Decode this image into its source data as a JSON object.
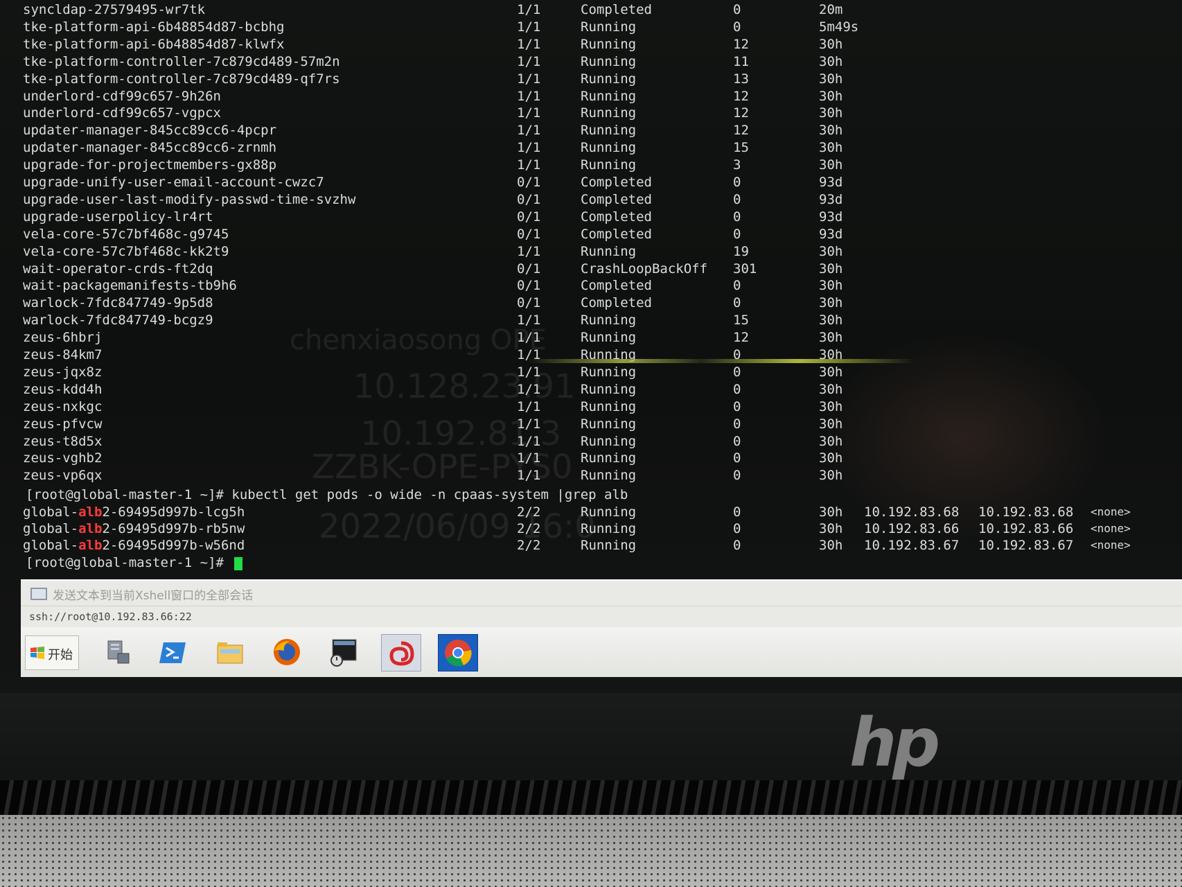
{
  "terminal": {
    "rows": [
      {
        "name": "syncldap-27579495-wr7tk",
        "ready": "1/1",
        "status": "Completed",
        "restarts": "0",
        "age": "20m"
      },
      {
        "name": "tke-platform-api-6b48854d87-bcbhg",
        "ready": "1/1",
        "status": "Running",
        "restarts": "0",
        "age": "5m49s"
      },
      {
        "name": "tke-platform-api-6b48854d87-klwfx",
        "ready": "1/1",
        "status": "Running",
        "restarts": "12",
        "age": "30h"
      },
      {
        "name": "tke-platform-controller-7c879cd489-57m2n",
        "ready": "1/1",
        "status": "Running",
        "restarts": "11",
        "age": "30h"
      },
      {
        "name": "tke-platform-controller-7c879cd489-qf7rs",
        "ready": "1/1",
        "status": "Running",
        "restarts": "13",
        "age": "30h"
      },
      {
        "name": "underlord-cdf99c657-9h26n",
        "ready": "1/1",
        "status": "Running",
        "restarts": "12",
        "age": "30h"
      },
      {
        "name": "underlord-cdf99c657-vgpcx",
        "ready": "1/1",
        "status": "Running",
        "restarts": "12",
        "age": "30h"
      },
      {
        "name": "updater-manager-845cc89cc6-4pcpr",
        "ready": "1/1",
        "status": "Running",
        "restarts": "12",
        "age": "30h"
      },
      {
        "name": "updater-manager-845cc89cc6-zrnmh",
        "ready": "1/1",
        "status": "Running",
        "restarts": "15",
        "age": "30h"
      },
      {
        "name": "upgrade-for-projectmembers-gx88p",
        "ready": "1/1",
        "status": "Running",
        "restarts": "3",
        "age": "30h"
      },
      {
        "name": "upgrade-unify-user-email-account-cwzc7",
        "ready": "0/1",
        "status": "Completed",
        "restarts": "0",
        "age": "93d"
      },
      {
        "name": "upgrade-user-last-modify-passwd-time-svzhw",
        "ready": "0/1",
        "status": "Completed",
        "restarts": "0",
        "age": "93d"
      },
      {
        "name": "upgrade-userpolicy-lr4rt",
        "ready": "0/1",
        "status": "Completed",
        "restarts": "0",
        "age": "93d"
      },
      {
        "name": "vela-core-57c7bf468c-g9745",
        "ready": "0/1",
        "status": "Completed",
        "restarts": "0",
        "age": "93d"
      },
      {
        "name": "vela-core-57c7bf468c-kk2t9",
        "ready": "1/1",
        "status": "Running",
        "restarts": "19",
        "age": "30h"
      },
      {
        "name": "wait-operator-crds-ft2dq",
        "ready": "0/1",
        "status": "CrashLoopBackOff",
        "restarts": "301",
        "age": "30h"
      },
      {
        "name": "wait-packagemanifests-tb9h6",
        "ready": "0/1",
        "status": "Completed",
        "restarts": "0",
        "age": "30h"
      },
      {
        "name": "warlock-7fdc847749-9p5d8",
        "ready": "0/1",
        "status": "Completed",
        "restarts": "0",
        "age": "30h"
      },
      {
        "name": "warlock-7fdc847749-bcgz9",
        "ready": "1/1",
        "status": "Running",
        "restarts": "15",
        "age": "30h"
      },
      {
        "name": "zeus-6hbrj",
        "ready": "1/1",
        "status": "Running",
        "restarts": "12",
        "age": "30h"
      },
      {
        "name": "zeus-84km7",
        "ready": "1/1",
        "status": "Running",
        "restarts": "0",
        "age": "30h"
      },
      {
        "name": "zeus-jqx8z",
        "ready": "1/1",
        "status": "Running",
        "restarts": "0",
        "age": "30h"
      },
      {
        "name": "zeus-kdd4h",
        "ready": "1/1",
        "status": "Running",
        "restarts": "0",
        "age": "30h"
      },
      {
        "name": "zeus-nxkgc",
        "ready": "1/1",
        "status": "Running",
        "restarts": "0",
        "age": "30h"
      },
      {
        "name": "zeus-pfvcw",
        "ready": "1/1",
        "status": "Running",
        "restarts": "0",
        "age": "30h"
      },
      {
        "name": "zeus-t8d5x",
        "ready": "1/1",
        "status": "Running",
        "restarts": "0",
        "age": "30h"
      },
      {
        "name": "zeus-vghb2",
        "ready": "1/1",
        "status": "Running",
        "restarts": "0",
        "age": "30h"
      },
      {
        "name": "zeus-vp6qx",
        "ready": "1/1",
        "status": "Running",
        "restarts": "0",
        "age": "30h"
      }
    ],
    "command_line": "[root@global-master-1 ~]# kubectl get pods -o wide -n cpaas-system |grep alb",
    "alb_rows": [
      {
        "prefix": "global-",
        "match": "alb",
        "suffix": "2-69495d997b-lcg5h",
        "ready": "2/2",
        "status": "Running",
        "restarts": "0",
        "age": "30h",
        "ip": "10.192.83.68",
        "node": "10.192.83.68",
        "nominated": "<none>"
      },
      {
        "prefix": "global-",
        "match": "alb",
        "suffix": "2-69495d997b-rb5nw",
        "ready": "2/2",
        "status": "Running",
        "restarts": "0",
        "age": "30h",
        "ip": "10.192.83.66",
        "node": "10.192.83.66",
        "nominated": "<none>"
      },
      {
        "prefix": "global-",
        "match": "alb",
        "suffix": "2-69495d997b-w56nd",
        "ready": "2/2",
        "status": "Running",
        "restarts": "0",
        "age": "30h",
        "ip": "10.192.83.67",
        "node": "10.192.83.67",
        "nominated": "<none>"
      }
    ],
    "final_prompt": "[root@global-master-1 ~]#",
    "watermark": [
      "chenxiaosong OPE",
      "10.128.23.91",
      "10.192.81.3",
      "ZZBK-OPE-PYS0",
      "2022/06/09 16:0"
    ]
  },
  "xshell": {
    "send_text_label": "发送文本到当前Xshell窗口的全部会话",
    "session_address": "ssh://root@10.192.83.66:22"
  },
  "taskbar": {
    "start_label": "开始",
    "icons": [
      "server-manager-icon",
      "powershell-icon",
      "file-explorer-icon",
      "firefox-icon",
      "remote-desktop-icon",
      "xshell-icon",
      "chrome-icon"
    ]
  },
  "colors": {
    "highlight": "#ff3b3b",
    "cursor": "#22dd44",
    "text": "#dcdcdc"
  }
}
